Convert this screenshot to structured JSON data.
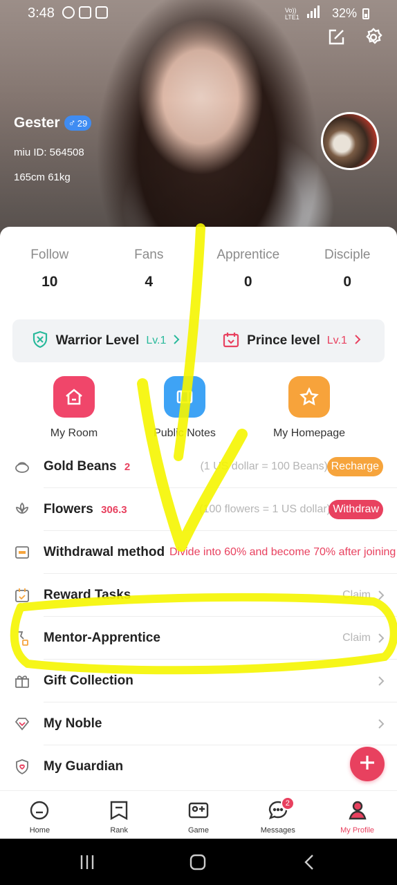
{
  "status_bar": {
    "time": "3:48",
    "battery": "32%",
    "network": "Vo)) LTE1"
  },
  "profile": {
    "name": "Gester",
    "age": "29",
    "miu_id": "miu ID: 564508",
    "body_stats": "165cm 61kg"
  },
  "counts": [
    {
      "label": "Follow",
      "value": "10"
    },
    {
      "label": "Fans",
      "value": "4"
    },
    {
      "label": "Apprentice",
      "value": "0"
    },
    {
      "label": "Disciple",
      "value": "0"
    }
  ],
  "levels": [
    {
      "name": "Warrior Level",
      "level": "Lv.1"
    },
    {
      "name": "Prince level",
      "level": "Lv.1"
    }
  ],
  "shortcuts": [
    {
      "label": "My Room"
    },
    {
      "label": "Public Notes"
    },
    {
      "label": "My Homepage"
    }
  ],
  "rows": {
    "gold_beans": {
      "title": "Gold Beans",
      "value": "2",
      "hint": "(1 US dollar = 100 Beans)",
      "action": "Recharge"
    },
    "flowers": {
      "title": "Flowers",
      "value": "306.3",
      "hint": "(100 flowers = 1 US dollar)",
      "action": "Withdraw"
    },
    "withdrawal": {
      "title": "Withdrawal method",
      "hint": "Divide into 60% and become 70% after joining"
    },
    "reward_tasks": {
      "title": "Reward Tasks",
      "hint": "Claim"
    },
    "mentor": {
      "title": "Mentor-Apprentice",
      "hint": "Claim"
    },
    "gift": {
      "title": "Gift Collection"
    },
    "noble": {
      "title": "My Noble"
    },
    "guardian": {
      "title": "My Guardian"
    }
  },
  "bottom_nav": [
    {
      "label": "Home"
    },
    {
      "label": "Rank"
    },
    {
      "label": "Game"
    },
    {
      "label": "Messages",
      "badge": "2"
    },
    {
      "label": "My Profile"
    }
  ],
  "colors": {
    "accent": "#e8415f",
    "green": "#28b99b",
    "orange": "#f6a43c",
    "annotation": "#f5f500"
  }
}
